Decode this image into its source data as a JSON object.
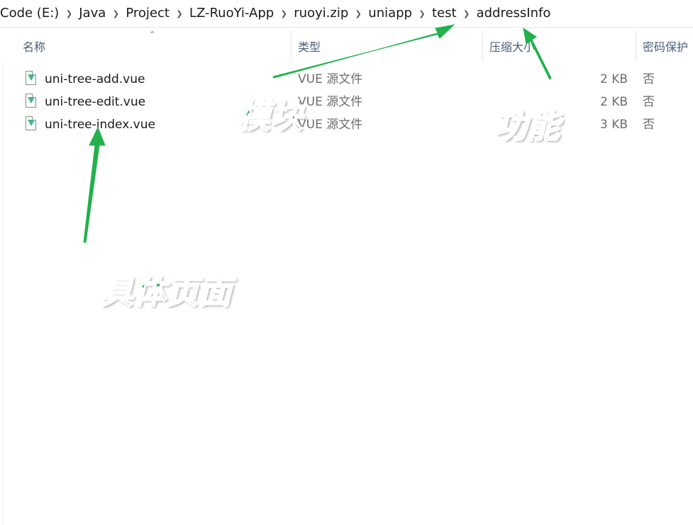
{
  "breadcrumb": [
    "Code (E:)",
    "Java",
    "Project",
    "LZ-RuoYi-App",
    "ruoyi.zip",
    "uniapp",
    "test",
    "addressInfo"
  ],
  "columns": {
    "name": "名称",
    "type": "类型",
    "compressed_size": "压缩大小",
    "password": "密码保护"
  },
  "files": [
    {
      "name": "uni-tree-add.vue",
      "type": "VUE 源文件",
      "size": "2 KB",
      "password": "否",
      "icon": "vue-file-icon"
    },
    {
      "name": "uni-tree-edit.vue",
      "type": "VUE 源文件",
      "size": "2 KB",
      "password": "否",
      "icon": "vue-file-icon"
    },
    {
      "name": "uni-tree-index.vue",
      "type": "VUE 源文件",
      "size": "3 KB",
      "password": "否",
      "icon": "vue-file-icon"
    }
  ],
  "annotations": {
    "module": "模块",
    "feature": "功能",
    "page": "具体页面",
    "color": "#22b14c"
  }
}
